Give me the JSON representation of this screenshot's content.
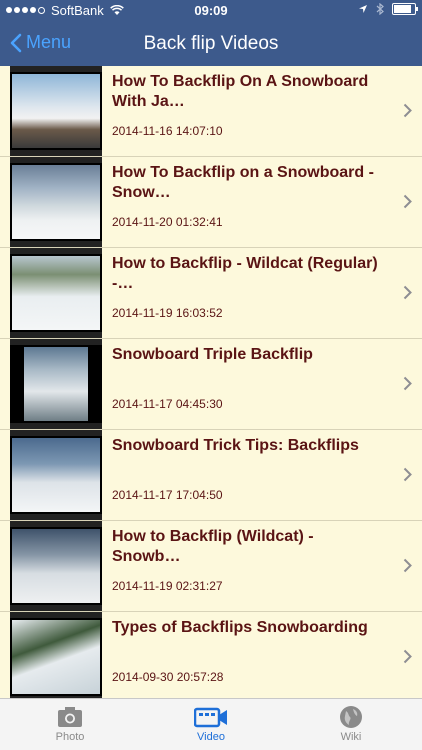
{
  "status": {
    "carrier": "SoftBank",
    "time": "09:09"
  },
  "nav": {
    "back_label": "Menu",
    "title": "Back flip Videos"
  },
  "videos": [
    {
      "title": "How To Backflip On A Snowboard With Ja…",
      "date": "2014-11-16 14:07:10"
    },
    {
      "title": "How To Backflip on a Snowboard - Snow…",
      "date": "2014-11-20 01:32:41"
    },
    {
      "title": "How to Backflip - Wildcat (Regular) -…",
      "date": "2014-11-19 16:03:52"
    },
    {
      "title": "Snowboard Triple Backflip",
      "date": "2014-11-17 04:45:30"
    },
    {
      "title": "Snowboard Trick Tips: Backflips",
      "date": "2014-11-17 17:04:50"
    },
    {
      "title": "How to Backflip (Wildcat) - Snowb…",
      "date": "2014-11-19 02:31:27"
    },
    {
      "title": "Types of Backflips Snowboarding",
      "date": "2014-09-30 20:57:28"
    }
  ],
  "tabs": [
    {
      "label": "Photo",
      "icon": "camera-icon"
    },
    {
      "label": "Video",
      "icon": "video-camera-icon"
    },
    {
      "label": "Wiki",
      "icon": "globe-icon"
    }
  ],
  "colors": {
    "bar": "#3d5a8c",
    "accent": "#1e6fd8",
    "list_bg": "#fdf9dc",
    "title_text": "#5a1414"
  }
}
